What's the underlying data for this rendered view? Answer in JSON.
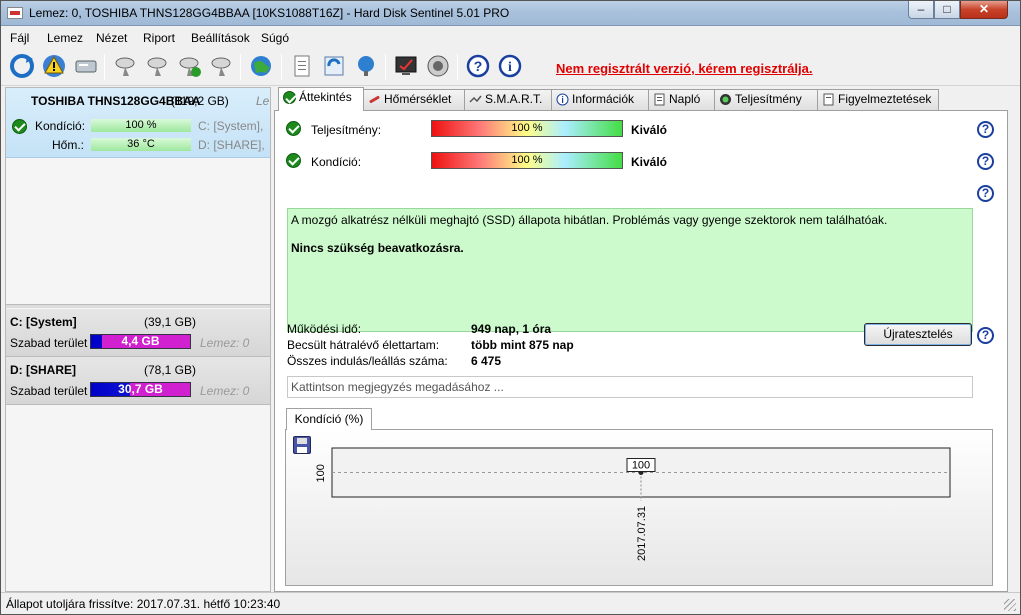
{
  "window": {
    "title": "Lemez: 0, TOSHIBA THNS128GG4BBAA [10KS1088T16Z]  -  Hard Disk Sentinel 5.01 PRO",
    "minimize": "–",
    "maximize": "□",
    "close": "✕"
  },
  "menu": [
    "Fájl",
    "Lemez",
    "Nézet",
    "Riport",
    "Beállítások",
    "Súgó"
  ],
  "toolbar": {
    "icons": [
      "refresh-icon",
      "warning-icon",
      "disk-icon",
      "satellite-dish-icon",
      "satellite-dish-icon",
      "satellite-dish-check-icon",
      "satellite-dish-icon",
      "globe-icon",
      "document-icon",
      "update-icon",
      "network-icon",
      "monitor-check-icon",
      "speaker-icon",
      "help-icon",
      "info-icon"
    ],
    "register_text": "Nem regisztrált verzió, kérem regisztrálja."
  },
  "disk": {
    "name": "TOSHIBA THNS128GG4BBAA",
    "size": "(119,2 GB)",
    "le": "Le",
    "condition_label": "Kondíció:",
    "condition_value": "100 %",
    "condition_pct": 100,
    "temp_label": "Hőm.:",
    "temp_value": "36 °C",
    "part1": "C: [System],",
    "part2": "D: [SHARE],"
  },
  "partitions": [
    {
      "name": "C: [System]",
      "size": "(39,1 GB)",
      "free_label": "Szabad terület",
      "free_value": "4,4 GB",
      "free_pct": 11,
      "lemez": "Lemez: 0"
    },
    {
      "name": "D: [SHARE]",
      "size": "(78,1 GB)",
      "free_label": "Szabad terület",
      "free_value": "30,7 GB",
      "free_pct": 39,
      "lemez": "Lemez: 0"
    }
  ],
  "tabs": [
    "Áttekintés",
    "Hőmérséklet",
    "S.M.A.R.T.",
    "Információk",
    "Napló",
    "Teljesítmény",
    "Figyelmeztetések"
  ],
  "overview": {
    "performance_label": "Teljesítmény:",
    "performance_value": "100 %",
    "performance_verdict": "Kiváló",
    "condition_label": "Kondíció:",
    "condition_value": "100 %",
    "condition_verdict": "Kiváló",
    "message": "A mozgó alkatrész nélküli meghajtó (SSD) állapota hibátlan. Problémás vagy gyenge szektorok nem találhatóak.",
    "action": "Nincs szükség beavatkozásra.",
    "uptime_label": "Működési idő:",
    "uptime_value": "949 nap, 1 óra",
    "lifetime_label": "Becsült hátralévő élettartam:",
    "lifetime_value": "több mint 875 nap",
    "startstop_label": "Összes indulás/leállás száma:",
    "startstop_value": "6 475",
    "reset_button": "Újratesztelés",
    "note_placeholder": "Kattintson megjegyzés megadásához ...",
    "help": "?"
  },
  "chart_tab": "Kondíció  (%)",
  "chart_data": {
    "type": "line",
    "x": [
      "2017.07.31"
    ],
    "series": [
      {
        "name": "Kondíció (%)",
        "values": [
          100
        ]
      }
    ],
    "data_labels": [
      "100"
    ],
    "ytick_labels": [
      "100"
    ],
    "xtick_labels": [
      "2017.07.31"
    ]
  },
  "status": "Állapot utoljára frissítve: 2017.07.31. hétfő 10:23:40"
}
